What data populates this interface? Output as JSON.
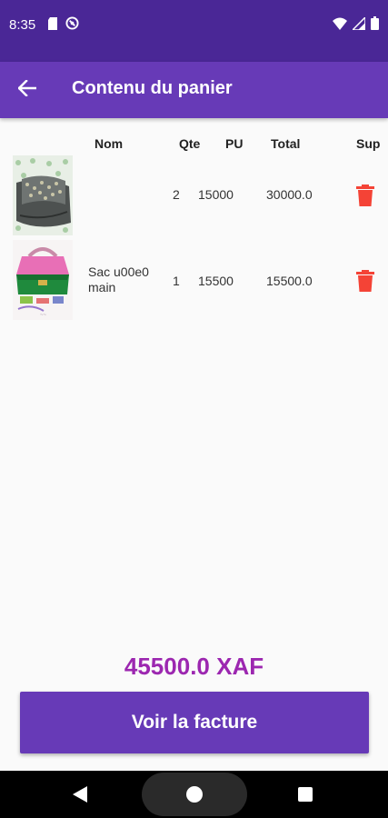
{
  "status_bar": {
    "time": "8:35",
    "icons_left": [
      "sd-card-icon",
      "no-sync-icon"
    ],
    "icons_right": [
      "wifi-icon",
      "signal-icon",
      "battery-icon"
    ]
  },
  "app_bar": {
    "title": "Contenu du panier",
    "background": "#673ab7"
  },
  "table": {
    "headers": {
      "nom": "Nom",
      "qte": "Qte",
      "pu": "PU",
      "total": "Total",
      "sup": "Sup"
    },
    "rows": [
      {
        "name": "",
        "qte": "2",
        "pu": "15000",
        "total": "30000.0",
        "image": "sandals-thumbnail"
      },
      {
        "name": "Sac u00e0 main",
        "qte": "1",
        "pu": "15500",
        "total": "15500.0",
        "image": "handbag-thumbnail"
      }
    ]
  },
  "total": {
    "amount": "45500.0 XAF",
    "color": "#9c27b0"
  },
  "invoice_button": {
    "label": "Voir la facture"
  },
  "nav_bar": {
    "icons": [
      "back-triangle-icon",
      "home-circle-icon",
      "recents-square-icon"
    ]
  },
  "colors": {
    "status_bar": "#4a2796",
    "primary": "#673ab7",
    "delete_icon": "#f44336"
  }
}
